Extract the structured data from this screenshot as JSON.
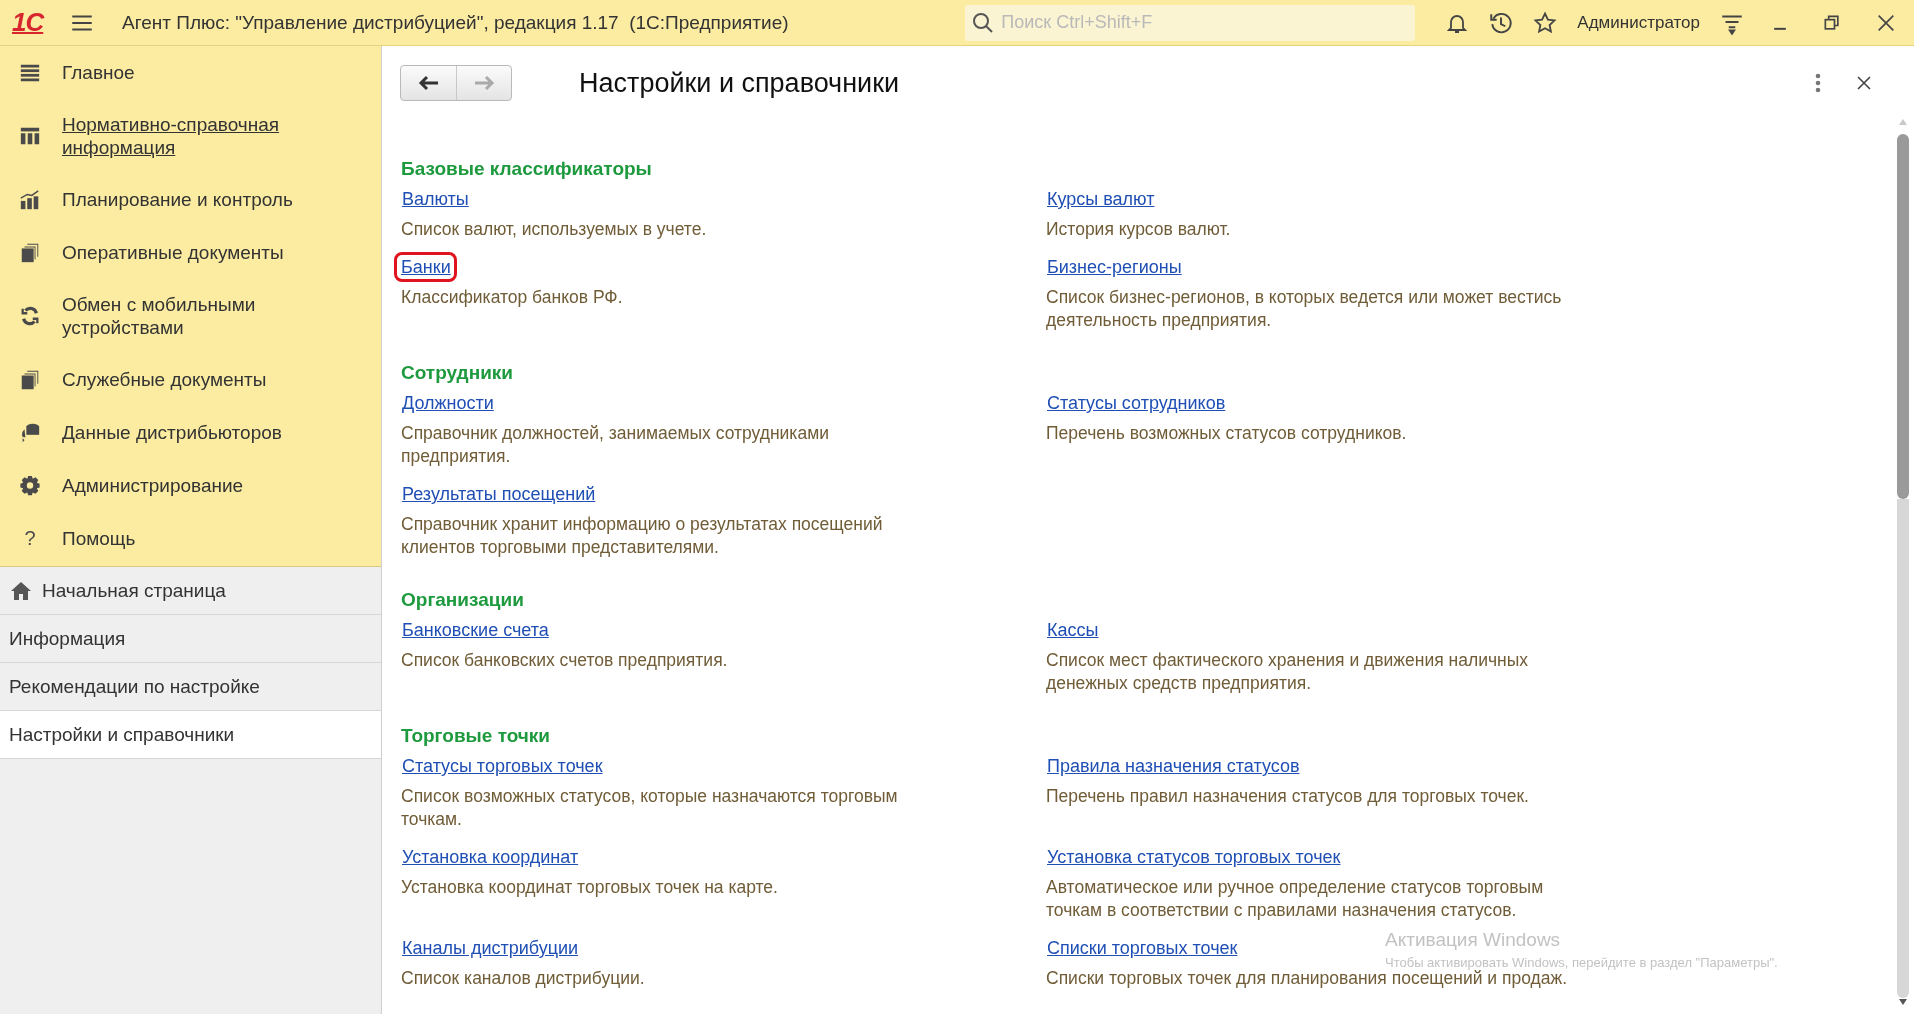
{
  "window": {
    "logo": "1С",
    "title": "Агент Плюс: \"Управление дистрибуцией\", редакция 1.17  (1С:Предприятие)",
    "search": {
      "placeholder": "Поиск Ctrl+Shift+F"
    },
    "user": "Администратор"
  },
  "sections_panel": [
    {
      "label": "Главное",
      "hovered": false
    },
    {
      "label": "Нормативно-справочная информация",
      "hovered": true
    },
    {
      "label": "Планирование и контроль",
      "hovered": false
    },
    {
      "label": "Оперативные документы",
      "hovered": false
    },
    {
      "label": "Обмен с мобильными устройствами",
      "hovered": false
    },
    {
      "label": "Служебные документы",
      "hovered": false
    },
    {
      "label": "Данные дистрибьюторов",
      "hovered": false
    },
    {
      "label": "Администрирование",
      "hovered": false
    },
    {
      "label": "Помощь",
      "hovered": false,
      "icon_text": "?"
    }
  ],
  "open_pages": [
    {
      "label": "Начальная страница",
      "selected": false,
      "kind": "home"
    },
    {
      "label": "Информация",
      "selected": false,
      "kind": "page"
    },
    {
      "label": "Рекомендации по настройке",
      "selected": false,
      "kind": "page"
    },
    {
      "label": "Настройки и справочники",
      "selected": true,
      "kind": "page"
    }
  ],
  "form": {
    "title": "Настройки и справочники",
    "back": {
      "disabled": false
    },
    "forward": {
      "disabled": true
    },
    "sections": [
      {
        "title": "Базовые классификаторы",
        "rows": [
          {
            "left": {
              "link": "Валюты",
              "description": "Список валют, используемых в учете.",
              "highlighted": false
            },
            "right": {
              "link": "Курсы валют",
              "description": "История курсов валют.",
              "highlighted": false
            }
          },
          {
            "left": {
              "link": "Банки",
              "description": "Классификатор банков РФ.",
              "highlighted": true
            },
            "right": {
              "link": "Бизнес-регионы",
              "description": "Список бизнес-регионов, в которых ведется или может вестись\nдеятельность предприятия.",
              "highlighted": false
            }
          }
        ]
      },
      {
        "title": "Сотрудники",
        "rows": [
          {
            "left": {
              "link": "Должности",
              "description": "Справочник должностей, занимаемых сотрудниками\nпредприятия.",
              "highlighted": false
            },
            "right": {
              "link": "Статусы сотрудников",
              "description": "Перечень возможных статусов сотрудников.",
              "highlighted": false
            }
          },
          {
            "left": {
              "link": "Результаты посещений",
              "description": "Справочник хранит информацию о результатах посещений\nклиентов торговыми представителями.",
              "highlighted": false
            }
          }
        ]
      },
      {
        "title": "Организации",
        "rows": [
          {
            "left": {
              "link": "Банковские счета",
              "description": "Список банковских счетов предприятия.",
              "highlighted": false
            },
            "right": {
              "link": "Кассы",
              "description": "Список мест фактического хранения и движения наличных\nденежных средств предприятия.",
              "highlighted": false
            }
          }
        ]
      },
      {
        "title": "Торговые точки",
        "rows": [
          {
            "left": {
              "link": "Статусы торговых точек",
              "description": "Список возможных статусов, которые назначаются торговым\nточкам.",
              "highlighted": false
            },
            "right": {
              "link": "Правила назначения статусов",
              "description": "Перечень правил назначения статусов для торговых точек.",
              "highlighted": false
            }
          },
          {
            "left": {
              "link": "Установка координат",
              "description": "Установка координат торговых точек на карте.",
              "highlighted": false
            },
            "right": {
              "link": "Установка статусов торговых точек",
              "description": "Автоматическое или ручное определение статусов торговым\nточкам в соответствии с правилами назначения статусов.",
              "highlighted": false
            }
          },
          {
            "left": {
              "link": "Каналы дистрибуции",
              "description": "Список каналов дистрибуции.",
              "highlighted": false
            },
            "right": {
              "link": "Списки торговых точек",
              "description": "Списки торговых точек для планирования посещений и продаж.",
              "highlighted": false
            }
          }
        ]
      }
    ]
  },
  "os_notice": {
    "title": "Активация Windows",
    "text": "Чтобы активировать Windows, перейдите в раздел \"Параметры\"."
  }
}
